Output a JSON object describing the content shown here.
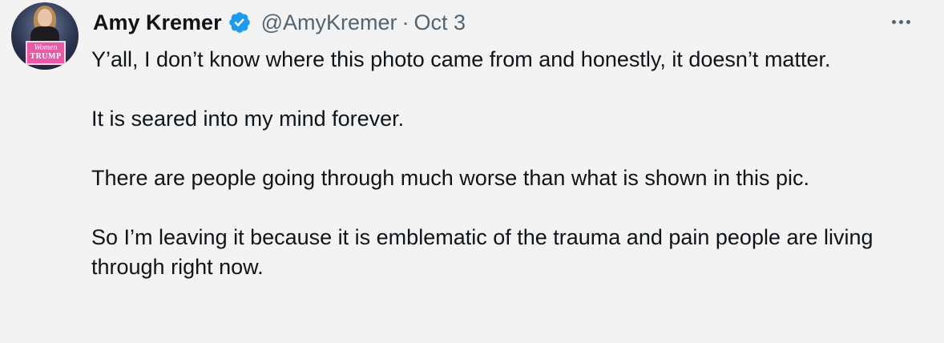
{
  "author": {
    "name": "Amy Kremer",
    "handle": "@AmyKremer",
    "separator": "·",
    "date": "Oct 3",
    "avatar_sign_line1": "Women",
    "avatar_sign_line2": "TRUMP",
    "verified_color": "#1d9bf0"
  },
  "icons": {
    "verified": "verified-badge-icon",
    "more": "more-options-icon"
  },
  "tweet": {
    "paragraphs": [
      "Y’all, I don’t know where this photo came from and honestly, it doesn’t matter.",
      "It is seared into my mind forever.",
      "There are people going through much worse than what is shown in this pic.",
      "So I’m leaving it because it is emblematic of the trauma and pain people are living through right now."
    ]
  }
}
